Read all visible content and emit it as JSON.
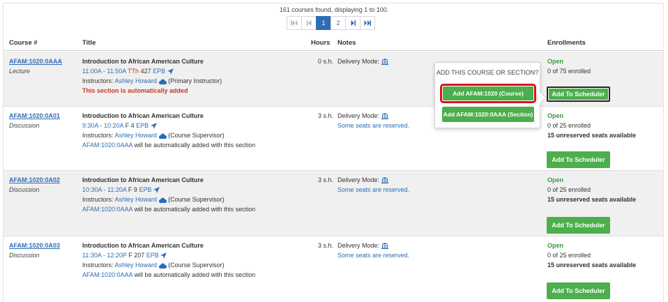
{
  "summary": "161 courses found, displaying 1 to 100.",
  "pager": {
    "pages": [
      "1",
      "2"
    ],
    "active": "1"
  },
  "headers": {
    "course": "Course #",
    "title": "Title",
    "hours": "Hours",
    "notes": "Notes",
    "enrollments": "Enrollments"
  },
  "rows": [
    {
      "course": "AFAM:1020:0AAA",
      "type": "Lecture",
      "title": "Introduction to African American Culture",
      "time": "11:00A - 11:50A",
      "days": "TTh",
      "room": "427",
      "building": "EPB",
      "instructor_label": "Instructors:",
      "instructor": "Ashley Howard",
      "role": "(Primary Instructor)",
      "auto_note": "This section is automatically added",
      "hours": "0 s.h.",
      "delivery": "Delivery Mode:",
      "status": "Open",
      "enrolled": "0 of 75 enrolled",
      "button": "Add To Scheduler"
    },
    {
      "course": "AFAM:1020:0A01",
      "type": "Discussion",
      "title": "Introduction to African American Culture",
      "time": "9:30A - 10:20A",
      "days": "F",
      "room": "4",
      "building": "EPB",
      "instructor_label": "Instructors:",
      "instructor": "Ashley Howard",
      "role": "(Course Supervisor)",
      "linked": "AFAM:1020:0AAA",
      "linked_note": "will be automatically added with this section",
      "hours": "3 s.h.",
      "delivery": "Delivery Mode:",
      "seats_note": "Some seats are reserved.",
      "status": "Open",
      "enrolled": "0 of 25 enrolled",
      "unreserved": "15 unreserved seats available",
      "button": "Add To Scheduler"
    },
    {
      "course": "AFAM:1020:0A02",
      "type": "Discussion",
      "title": "Introduction to African American Culture",
      "time": "10:30A - 11:20A",
      "days": "F",
      "room": "9",
      "building": "EPB",
      "instructor_label": "Instructors:",
      "instructor": "Ashley Howard",
      "role": "(Course Supervisor)",
      "linked": "AFAM:1020:0AAA",
      "linked_note": "will be automatically added with this section",
      "hours": "3 s.h.",
      "delivery": "Delivery Mode:",
      "seats_note": "Some seats are reserved.",
      "status": "Open",
      "enrolled": "0 of 25 enrolled",
      "unreserved": "15 unreserved seats available",
      "button": "Add To Scheduler"
    },
    {
      "course": "AFAM:1020:0A03",
      "type": "Discussion",
      "title": "Introduction to African American Culture",
      "time": "11:30A - 12:20P",
      "days": "F",
      "room": "207",
      "building": "EPB",
      "instructor_label": "Instructors:",
      "instructor": "Ashley Howard",
      "role": "(Course Supervisor)",
      "linked": "AFAM:1020:0AAA",
      "linked_note": "will be automatically added with this section",
      "hours": "3 s.h.",
      "delivery": "Delivery Mode:",
      "seats_note": "Some seats are reserved.",
      "status": "Open",
      "enrolled": "0 of 25 enrolled",
      "unreserved": "15 unreserved seats available",
      "button": "Add To Scheduler"
    }
  ],
  "popover": {
    "title": "ADD THIS COURSE OR SECTION?",
    "course_button": "Add AFAM:1020 (Course)",
    "section_button": "Add AFAM:1020:0AAA (Section)"
  },
  "colors": {
    "accent": "#2d6db5",
    "green": "#4cae4c",
    "highlight": "#e0101a",
    "open": "#3a9b3a",
    "warning": "#c0392b"
  },
  "icons": {
    "delivery": "institution-icon",
    "instructor": "cloud-icon",
    "building": "location-arrow-icon"
  }
}
